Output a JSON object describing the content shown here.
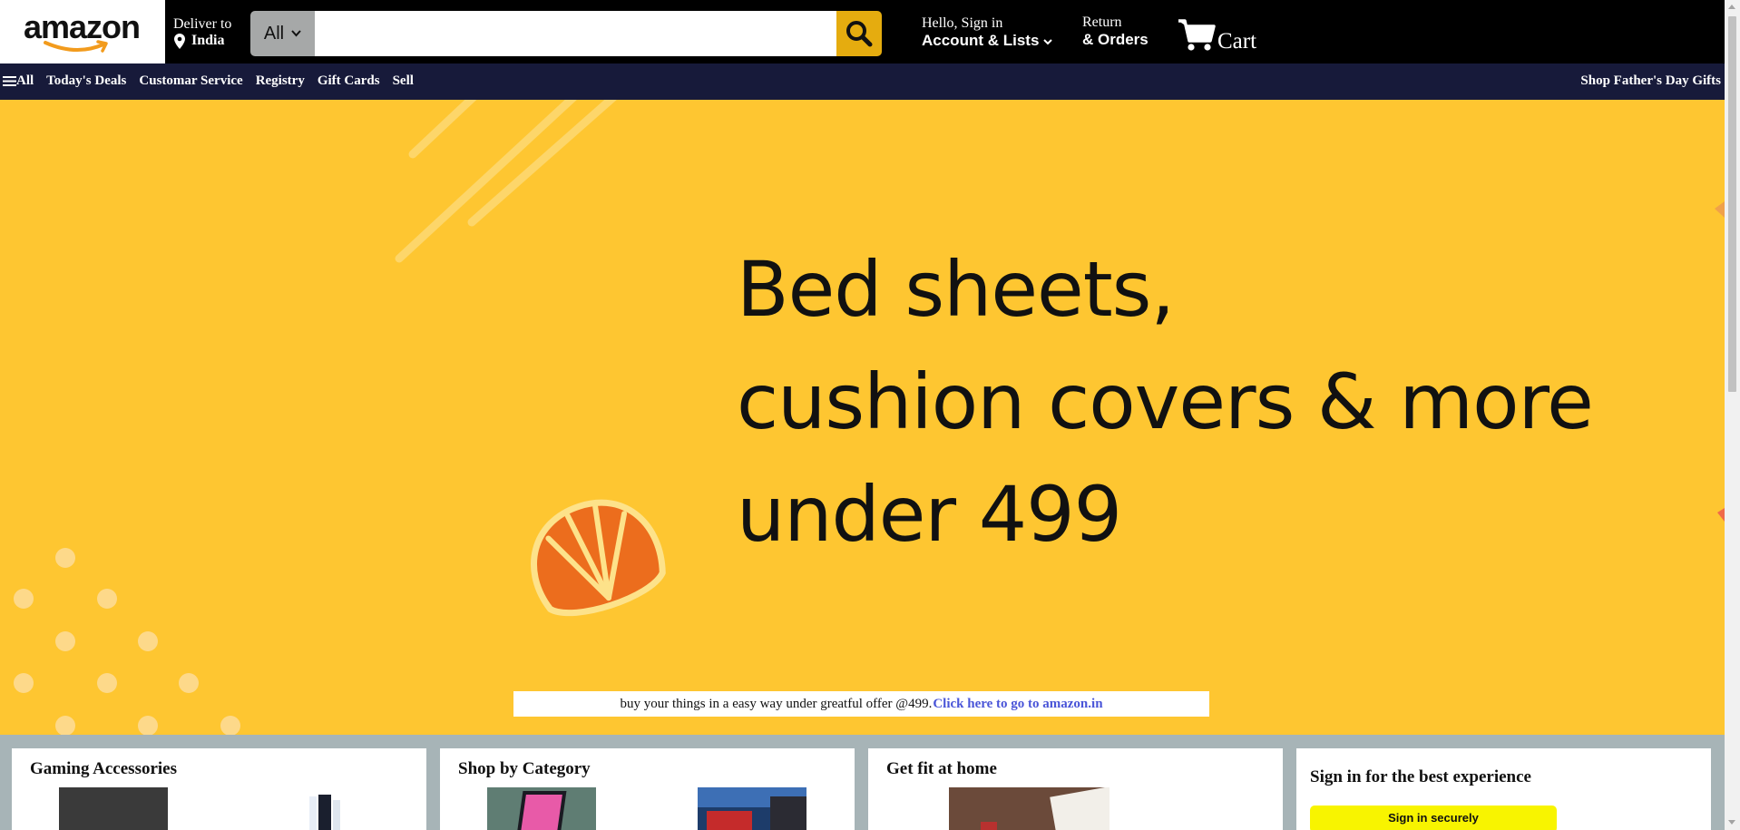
{
  "header": {
    "logo_text": "amazon",
    "deliver_line1": "Deliver to",
    "deliver_location": "India",
    "search": {
      "category": "All",
      "placeholder": "",
      "value": ""
    },
    "account_greeting": "Hello, Sign in",
    "account_label": "Account & Lists",
    "returns_line1": "Return",
    "returns_line2": "& Orders",
    "cart_label": "Cart"
  },
  "nav": {
    "all_label": "All",
    "items": [
      "Today's Deals",
      "Customar Service",
      "Registry",
      "Gift Cards",
      "Sell"
    ],
    "promo": "Shop Father's Day Gifts"
  },
  "hero": {
    "lines": [
      "Bed sheets,",
      "cushion covers & more",
      "under 499"
    ],
    "offer_text": "buy your things in a easy way under greatful offer @499.",
    "offer_link": "Click here to go to amazon.in"
  },
  "cards": [
    {
      "title": "Gaming Accessories"
    },
    {
      "title": "Shop by Category"
    },
    {
      "title": "Get fit at home"
    }
  ],
  "signin_card": {
    "title": "Sign in for the best experience",
    "button": "Sign in securely"
  },
  "colors": {
    "header_bg": "#000000",
    "nav_bg": "#171a3a",
    "hero_bg": "#fec631",
    "search_button": "#e5ac0f",
    "signin_button": "#f8f400",
    "offer_link": "#4a55d8"
  }
}
